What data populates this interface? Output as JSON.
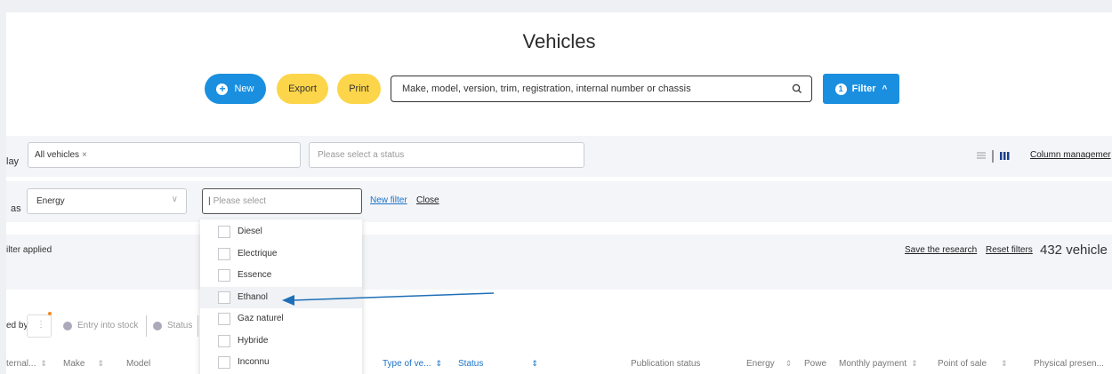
{
  "page_title": "Vehicles",
  "toolbar": {
    "new_label": "New",
    "export_label": "Export",
    "print_label": "Print",
    "search_placeholder": "Make, model, version, trim, registration, internal number or chassis",
    "filter_label": "Filter",
    "filter_count": "1"
  },
  "display_row": {
    "label": "lay",
    "chip_text": "All vehicles",
    "status_placeholder": "Please select a status",
    "column_management": "Column managemer"
  },
  "filter_row": {
    "label": "as",
    "field_value": "Energy",
    "select_placeholder": "Please select",
    "new_filter": "New filter",
    "close": "Close"
  },
  "dropdown": {
    "options": [
      "Diesel",
      "Electrique",
      "Essence",
      "Ethanol",
      "Gaz naturel",
      "Hybride",
      "Inconnu"
    ],
    "highlighted": "Ethanol"
  },
  "results_row": {
    "applied_text": "ilter applied",
    "save_research": "Save the research",
    "reset_filters": "Reset filters",
    "count": "432 vehicle"
  },
  "sort_row": {
    "label": "ed by",
    "chip_entry": "Entry into stock",
    "chip_status": "Status"
  },
  "table_headers": [
    "ternal...",
    "Make",
    "Model",
    "Type of ve...",
    "Status",
    "Publication status",
    "Energy",
    "Powe",
    "Monthly payment",
    "Point of sale",
    "Physical presen..."
  ],
  "colors": {
    "primary_blue": "#1a8fe0",
    "yellow": "#fdd54a",
    "arrow": "#1e6fb8"
  }
}
